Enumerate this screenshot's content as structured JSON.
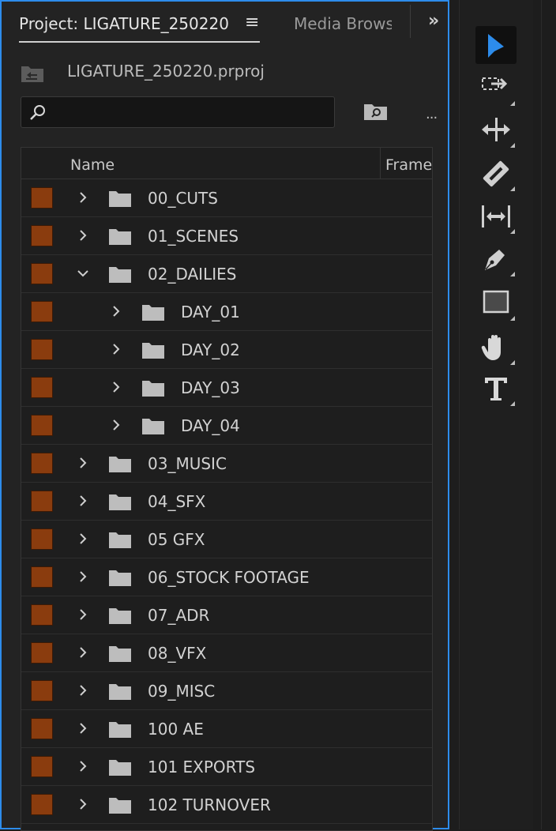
{
  "project_panel": {
    "tabs": [
      {
        "label": "Project: LIGATURE_250220",
        "active": true
      },
      {
        "label": "Media Browser",
        "active": false
      }
    ],
    "project_file": "LIGATURE_250220.prproj",
    "search": {
      "value": "",
      "placeholder": ""
    },
    "columns": [
      "Name",
      "Frame"
    ],
    "label_color": "#8a3c0e",
    "bins": [
      {
        "name": "00_CUTS",
        "level": 0,
        "expanded": false
      },
      {
        "name": "01_SCENES",
        "level": 0,
        "expanded": false
      },
      {
        "name": "02_DAILIES",
        "level": 0,
        "expanded": true
      },
      {
        "name": "DAY_01",
        "level": 1,
        "expanded": false
      },
      {
        "name": "DAY_02",
        "level": 1,
        "expanded": false
      },
      {
        "name": "DAY_03",
        "level": 1,
        "expanded": false
      },
      {
        "name": "DAY_04",
        "level": 1,
        "expanded": false
      },
      {
        "name": "03_MUSIC",
        "level": 0,
        "expanded": false
      },
      {
        "name": "04_SFX",
        "level": 0,
        "expanded": false
      },
      {
        "name": "05 GFX",
        "level": 0,
        "expanded": false
      },
      {
        "name": "06_STOCK FOOTAGE",
        "level": 0,
        "expanded": false
      },
      {
        "name": "07_ADR",
        "level": 0,
        "expanded": false
      },
      {
        "name": "08_VFX",
        "level": 0,
        "expanded": false
      },
      {
        "name": "09_MISC",
        "level": 0,
        "expanded": false
      },
      {
        "name": "100 AE",
        "level": 0,
        "expanded": false
      },
      {
        "name": "101 EXPORTS",
        "level": 0,
        "expanded": false
      },
      {
        "name": "102 TURNOVER",
        "level": 0,
        "expanded": false
      }
    ]
  },
  "tools": [
    {
      "icon": "selection-tool-icon",
      "active": true
    },
    {
      "icon": "track-select-forward-icon",
      "active": false
    },
    {
      "icon": "ripple-edit-icon",
      "active": false
    },
    {
      "icon": "razor-icon",
      "active": false
    },
    {
      "icon": "slip-icon",
      "active": false
    },
    {
      "icon": "pen-icon",
      "active": false
    },
    {
      "icon": "rectangle-icon",
      "active": false
    },
    {
      "icon": "hand-icon",
      "active": false
    },
    {
      "icon": "type-icon",
      "active": false
    }
  ],
  "colors": {
    "accent": "#2d8ceb",
    "active_tool": "#2d8ceb",
    "label": "#8a3c0e"
  }
}
